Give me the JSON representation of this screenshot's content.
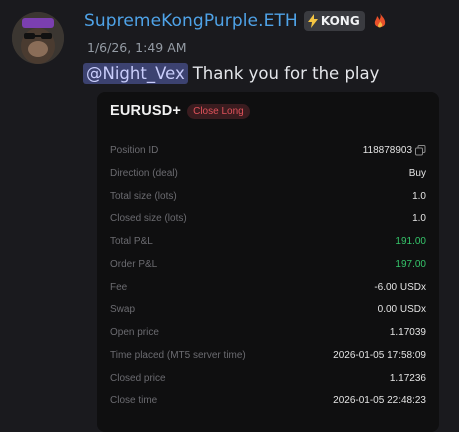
{
  "message": {
    "username": "SupremeKongPurple.ETH",
    "tag": "KONG",
    "timestamp": "1/6/26, 1:49 AM",
    "mention": "@Night_Vex",
    "text": "Thank you for the play"
  },
  "card": {
    "symbol": "EURUSD+",
    "badge": "Close Long",
    "rows": [
      {
        "label": "Position ID",
        "value": "118878903"
      },
      {
        "label": "Direction (deal)",
        "value": "Buy"
      },
      {
        "label": "Total size (lots)",
        "value": "1.0"
      },
      {
        "label": "Closed size (lots)",
        "value": "1.0"
      },
      {
        "label": "Total P&L",
        "value": "191.00"
      },
      {
        "label": "Order P&L",
        "value": "197.00"
      },
      {
        "label": "Fee",
        "value": "-6.00 USDx"
      },
      {
        "label": "Swap",
        "value": "0.00 USDx"
      },
      {
        "label": "Open price",
        "value": "1.17039"
      },
      {
        "label": "Time placed (MT5 server time)",
        "value": "2026-01-05 17:58:09"
      },
      {
        "label": "Closed price",
        "value": "1.17236"
      },
      {
        "label": "Close time",
        "value": "2026-01-05 22:48:23"
      }
    ]
  },
  "colors": {
    "username": "#4fa3e8",
    "mention_bg": "#3c4270",
    "profit": "#35c46a",
    "close_badge": "#e0525a"
  },
  "icons": {
    "tag_icon": "lightning-bolt-icon",
    "extra_badge": "flame-icon",
    "copy": "copy-icon"
  }
}
